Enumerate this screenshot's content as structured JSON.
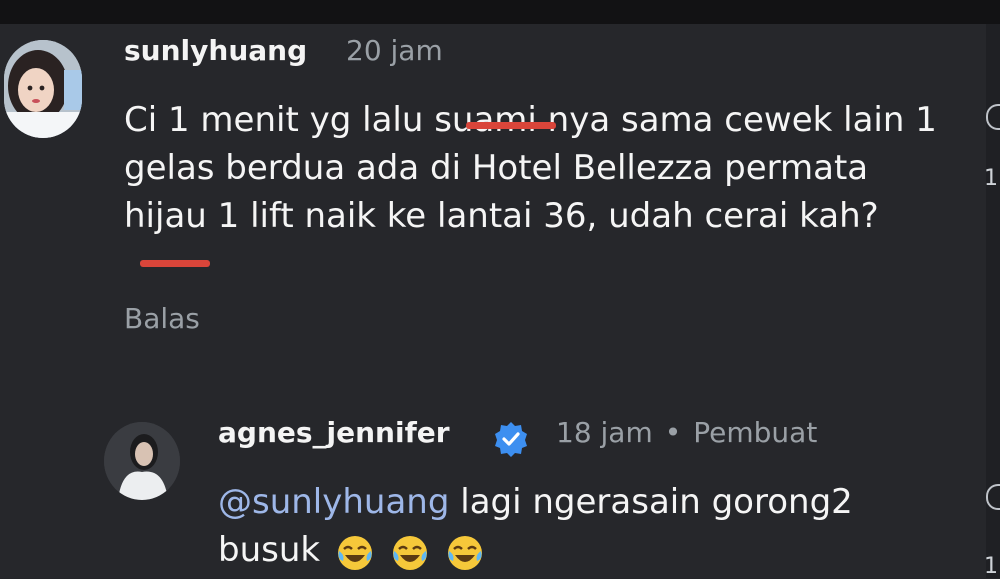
{
  "comments": [
    {
      "username": "sunlyhuang",
      "time": "20 jam",
      "text": "Ci 1 menit yg lalu suami nya sama cewek lain 1 gelas berdua ada di Hotel Bellezza permata hijau 1 lift naik ke lantai 36, udah cerai kah?",
      "reply_label": "Balas"
    },
    {
      "username": "agnes_jennifer",
      "time": "18 jam",
      "separator": "•",
      "creator_label": "Pembuat",
      "mention": "@sunlyhuang",
      "text": "lagi ngerasain gorong2 busuk",
      "emojis": [
        "laughing-tears-emoji",
        "laughing-tears-emoji",
        "laughing-tears-emoji"
      ]
    }
  ],
  "edge_counts": [
    "1",
    "1"
  ],
  "colors": {
    "background": "#26272b",
    "muted_text": "#9aa0a6",
    "mention": "#9eb7e8",
    "verified_badge": "#3d8ff0",
    "censor_mark": "#d9453a"
  }
}
